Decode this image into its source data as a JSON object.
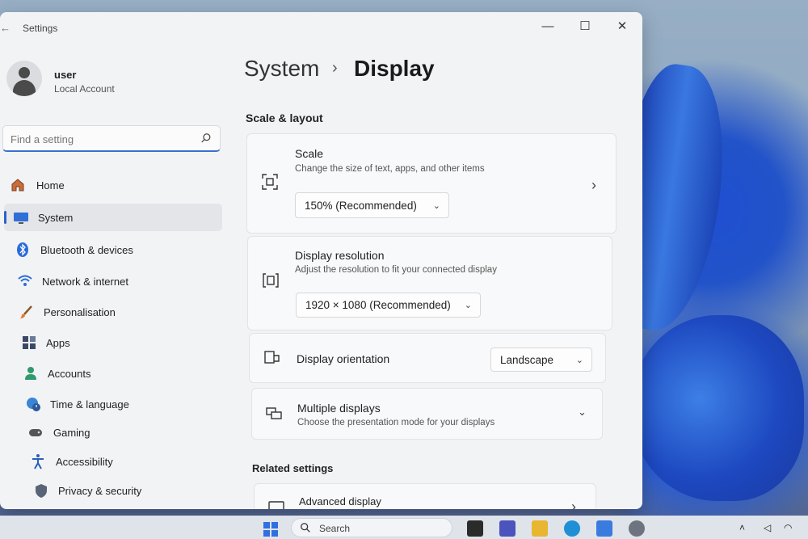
{
  "window": {
    "title": "Settings",
    "controls": {
      "minimize": "—",
      "maximize": "☐",
      "close": "✕"
    }
  },
  "profile": {
    "name": "user",
    "account_type": "Local Account"
  },
  "search": {
    "placeholder": "Find a setting"
  },
  "sidebar": {
    "items": [
      {
        "label": "Home",
        "icon": "home-icon"
      },
      {
        "label": "System",
        "icon": "monitor-icon",
        "active": true
      },
      {
        "label": "Bluetooth & devices",
        "icon": "bluetooth-icon"
      },
      {
        "label": "Network & internet",
        "icon": "wifi-icon"
      },
      {
        "label": "Personalisation",
        "icon": "brush-icon"
      },
      {
        "label": "Apps",
        "icon": "apps-icon"
      },
      {
        "label": "Accounts",
        "icon": "person-icon"
      },
      {
        "label": "Time & language",
        "icon": "globe-clock-icon"
      },
      {
        "label": "Gaming",
        "icon": "gamepad-icon"
      },
      {
        "label": "Accessibility",
        "icon": "accessibility-icon"
      },
      {
        "label": "Privacy & security",
        "icon": "shield-icon"
      }
    ]
  },
  "breadcrumb": {
    "parent": "System",
    "separator": "›",
    "current": "Display"
  },
  "sections": {
    "scale_layout": "Scale & layout",
    "related": "Related settings"
  },
  "cards": {
    "scale": {
      "title": "Scale",
      "subtitle": "Change the size of text, apps, and other items",
      "value": "150% (Recommended)"
    },
    "resolution": {
      "title": "Display resolution",
      "subtitle": "Adjust the resolution to fit your connected display",
      "value": "1920 × 1080 (Recommended)"
    },
    "orientation": {
      "title": "Display orientation",
      "value": "Landscape"
    },
    "multiple": {
      "title": "Multiple displays",
      "subtitle": "Choose the presentation mode for your displays"
    },
    "advanced": {
      "title": "Advanced display"
    }
  },
  "taskbar": {
    "search_label": "Search"
  },
  "colors": {
    "accent": "#2a62c8",
    "window_bg": "#f2f3f5",
    "card_bg": "#f8f9fa"
  }
}
